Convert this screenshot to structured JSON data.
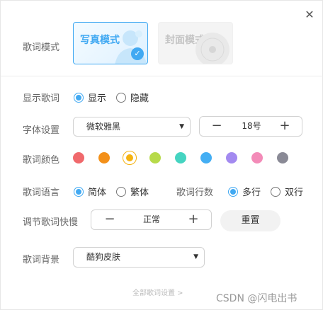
{
  "dialog": {
    "close_icon": "close-icon"
  },
  "lyric_mode": {
    "label": "歌词模式",
    "options": [
      {
        "label": "写真模式",
        "selected": true
      },
      {
        "label": "封面模式",
        "selected": false
      }
    ]
  },
  "show_lyrics": {
    "label": "显示歌词",
    "options": [
      {
        "label": "显示",
        "checked": true
      },
      {
        "label": "隐藏",
        "checked": false
      }
    ]
  },
  "font": {
    "label": "字体设置",
    "family": "微软雅黑",
    "size": "18号"
  },
  "lyric_color": {
    "label": "歌词颜色",
    "swatches": [
      "#f0696c",
      "#f39019",
      "#f5b20f",
      "#b7da4a",
      "#45d4c1",
      "#44aef3",
      "#a38af0",
      "#f38bb8",
      "#8a8a96"
    ],
    "selected_index": 2
  },
  "lyric_language": {
    "label": "歌词语言",
    "options": [
      {
        "label": "简体",
        "checked": true
      },
      {
        "label": "繁体",
        "checked": false
      }
    ]
  },
  "lyric_lines": {
    "label": "歌词行数",
    "options": [
      {
        "label": "多行",
        "checked": true
      },
      {
        "label": "双行",
        "checked": false
      }
    ]
  },
  "speed": {
    "label": "调节歌词快慢",
    "value": "正常",
    "reset_label": "重置"
  },
  "background": {
    "label": "歌词背景",
    "value": "酷狗皮肤"
  },
  "footer": {
    "all_settings_label": "全部歌词设置 >"
  },
  "watermark": "CSDN @闪电出书",
  "accent_color": "#41a9f2"
}
